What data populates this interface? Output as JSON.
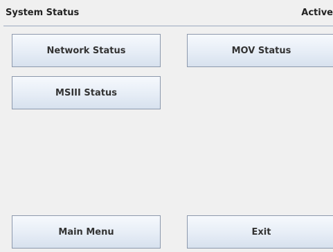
{
  "header": {
    "title": "System Status",
    "status": "Active"
  },
  "buttons": {
    "network_status": "Network Status",
    "mov_status": "MOV Status",
    "msiii_status": "MSIII Status",
    "main_menu": "Main Menu",
    "exit": "Exit"
  },
  "colors": {
    "background": "#f0f0f0",
    "divider": "#9aa8c0",
    "button_border": "#8c98ac",
    "button_text": "#333333"
  }
}
